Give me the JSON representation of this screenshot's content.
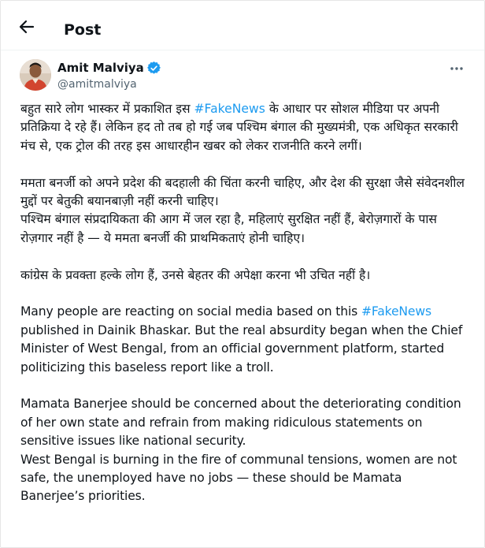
{
  "header": {
    "title": "Post"
  },
  "author": {
    "display_name": "Amit Malviya",
    "handle": "@amitmalviya",
    "verified": true
  },
  "colors": {
    "link": "#1d9bf0",
    "verified_badge": "#1d9bf0",
    "text": "#0f1419",
    "secondary_text": "#536471"
  },
  "tweet": {
    "hi_p1_a": "बहुत सारे लोग भास्कर में प्रकाशित इस ",
    "hi_p1_tag": "#FakeNews",
    "hi_p1_b": " के आधार पर सोशल मीडिया पर अपनी प्रतिक्रिया दे रहे हैं। लेकिन हद तो तब हो गई जब पश्चिम बंगाल की मुख्यमंत्री, एक अधिकृत सरकारी मंच से, एक ट्रोल की तरह इस आधारहीन खबर को लेकर राजनीति करने लगीं।",
    "hi_p2": "ममता बनर्जी को अपने प्रदेश की बदहाली की चिंता करनी चाहिए, और देश की सुरक्षा जैसे संवेदनशील मुद्दों पर बेतुकी बयानबाज़ी नहीं करनी चाहिए।",
    "hi_p3": "पश्चिम बंगाल संप्रदायिकता की आग में जल रहा है, महिलाएं सुरक्षित नहीं हैं, बेरोज़गारों के पास रोज़गार नहीं है — ये ममता बनर्जी की प्राथमिकताएं होनी चाहिए।",
    "hi_p4": "कांग्रेस के प्रवक्ता हल्के लोग हैं, उनसे बेहतर की अपेक्षा करना भी उचित नहीं है।",
    "en_p1_a": "Many people are reacting on social media based on this ",
    "en_p1_tag": "#FakeNews",
    "en_p1_b": " published in Dainik Bhaskar. But the real absurdity began when the Chief Minister of West Bengal, from an official government platform, started politicizing this baseless report like a troll.",
    "en_p2": "Mamata Banerjee should be concerned about the deteriorating condition of her own state and refrain from making ridiculous statements on sensitive issues like national security.",
    "en_p3": "West Bengal is burning in the fire of communal tensions, women are not safe, the unemployed have no jobs — these should be Mamata Banerjee’s priorities."
  },
  "icons": {
    "back": "arrow-left-icon",
    "more": "more-horizontal-icon",
    "verified": "verified-badge-icon"
  }
}
